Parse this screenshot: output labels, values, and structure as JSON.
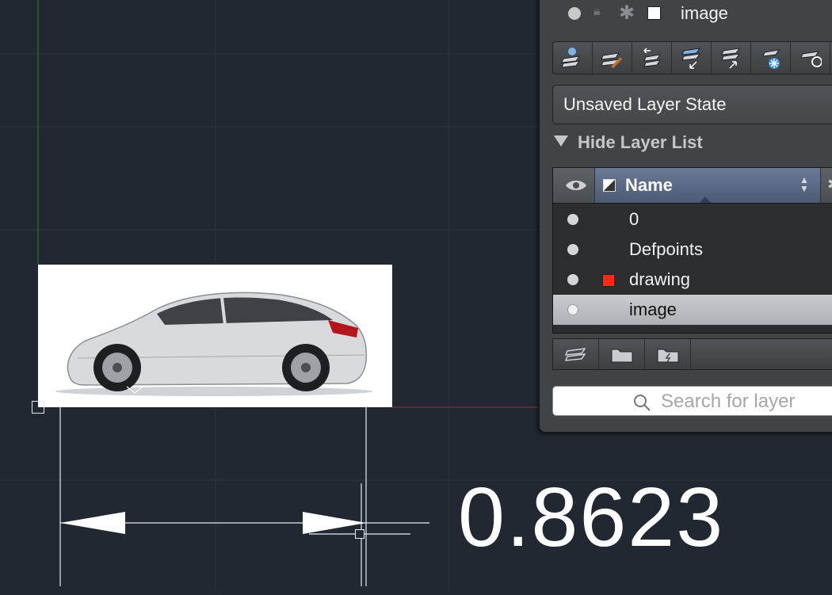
{
  "canvas": {
    "dimension_value": "0.8623",
    "colors": {
      "background": "#212831",
      "grid": "#2b3440",
      "x_axis": "#a33232",
      "y_axis": "#2f7a3a"
    }
  },
  "layers_panel": {
    "current_layer": {
      "name": "image"
    },
    "toolbar_icons": [
      "new-layer-icon",
      "set-current-icon",
      "previous-state-icon",
      "move-to-layer-icon",
      "make-current-from-object-icon",
      "freeze-icon",
      "isolate-icon"
    ],
    "layer_state": "Unsaved Layer State",
    "hide_list_label": "Hide Layer List",
    "columns": {
      "name": "Name"
    },
    "layers": [
      {
        "name": "0",
        "color": ""
      },
      {
        "name": "Defpoints",
        "color": ""
      },
      {
        "name": "drawing",
        "color": "#ff2a1a"
      },
      {
        "name": "image",
        "color": "",
        "selected": true
      }
    ],
    "bottom_icons": [
      "new-layer-icon",
      "group-folder-icon",
      "filter-folder-icon"
    ],
    "search": {
      "placeholder": "Search for layer",
      "value": ""
    }
  }
}
